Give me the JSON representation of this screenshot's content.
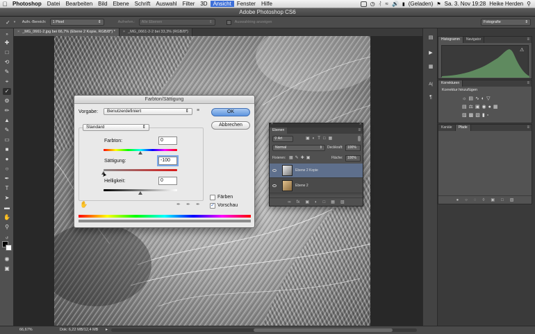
{
  "menubar": {
    "app": "Photoshop",
    "items": [
      "Datei",
      "Bearbeiten",
      "Bild",
      "Ebene",
      "Schrift",
      "Auswahl",
      "Filter",
      "3D",
      "Ansicht",
      "Fenster",
      "Hilfe"
    ],
    "battery": "(Geladen)",
    "clock": "Sa. 3. Nov  19:28",
    "user": "Heike Herden"
  },
  "window_title": "Adobe Photoshop CS6",
  "options": {
    "area_label": "Aufn.-Bereich:",
    "area_value": "1 Pixel",
    "sample_label": "Aufnehm.:",
    "sample_value": "Alle Ebenen",
    "ring_label": "Auswahlring anzeigen",
    "workspace": "Fotografie"
  },
  "tabs": [
    {
      "label": "_MG_0661-2.jpg bei 66,7% (Ebene 2 Kopie, RGB/8*) *",
      "active": true
    },
    {
      "label": "_MG_0661-2-2 bei 33,3% (RGB/8*)",
      "active": false
    }
  ],
  "status": {
    "zoom": "66,67%",
    "doc": "Dok: 6,22 MB/12,4 MB"
  },
  "histogram_panel": {
    "tabs": [
      "Histogramm",
      "Navigator"
    ]
  },
  "corrections_panel": {
    "tabs": [
      "Korrekturen"
    ],
    "add_label": "Korrektur hinzufügen"
  },
  "channels_panel": {
    "tabs": [
      "Kanäle",
      "Pfade"
    ]
  },
  "layers_panel": {
    "title": "Ebenen",
    "kind": "Art",
    "blend": "Normal",
    "opacity_label": "Deckkraft:",
    "opacity_value": "100%",
    "lock_label": "Fixieren:",
    "fill_label": "Fläche:",
    "fill_value": "100%",
    "layers": [
      {
        "name": "Ebene 2 Kopie",
        "selected": true
      },
      {
        "name": "Ebene 2",
        "selected": false
      }
    ]
  },
  "dialog": {
    "title": "Farbton/Sättigung",
    "preset_label": "Vorgabe:",
    "preset_value": "Benutzerdefiniert",
    "ok": "OK",
    "cancel": "Abbrechen",
    "channel": "Standard",
    "hue_label": "Farbton:",
    "hue_value": "0",
    "saturation_label": "Sättigung:",
    "saturation_value": "-100",
    "lightness_label": "Helligkeit:",
    "lightness_value": "0",
    "colorize_label": "Färben",
    "preview_label": "Vorschau",
    "colorize_checked": false,
    "preview_checked": true
  },
  "colors": {
    "accent": "#3d6fd8",
    "ok_button": "#5e95df",
    "histogram_fill": "#5f8a5f",
    "selected_layer": "#5e6f8c"
  }
}
